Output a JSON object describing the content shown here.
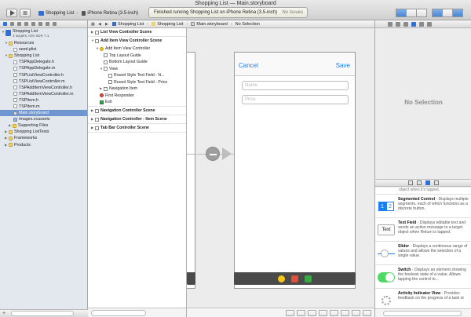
{
  "window": {
    "title": "Shopping List — Main.storyboard"
  },
  "toolbar": {
    "scheme": "Shopping List",
    "device": "iPhone Retina (3.5-inch)",
    "activity_status": "Finished running Shopping List on iPhone Retina (3.5-inch)",
    "issues": "No Issues"
  },
  "navigator": {
    "project_name": "Shopping List",
    "project_subtitle": "2 targets, iOS SDK 7.1",
    "items": [
      {
        "label": "Resources"
      },
      {
        "label": "seed.plist"
      },
      {
        "label": "Shopping List"
      },
      {
        "label": "TSPAppDelegate.h"
      },
      {
        "label": "TSPAppDelegate.m"
      },
      {
        "label": "TSPListViewController.h"
      },
      {
        "label": "TSPListViewController.m"
      },
      {
        "label": "TSPAddItemViewController.h"
      },
      {
        "label": "TSPAddItemViewController.m"
      },
      {
        "label": "TSPItem.h"
      },
      {
        "label": "TSPItem.m"
      },
      {
        "label": "Main.storyboard"
      },
      {
        "label": "Images.xcassets"
      },
      {
        "label": "Supporting Files"
      },
      {
        "label": "Shopping ListTests"
      },
      {
        "label": "Frameworks"
      },
      {
        "label": "Products"
      }
    ]
  },
  "jumpbar": {
    "crumbs": [
      "Shopping List",
      "Shopping List",
      "Main.storyboard",
      "No Selection"
    ]
  },
  "outline": {
    "rows": [
      {
        "label": "List View Controller Scene"
      },
      {
        "label": "Add Item View Controller Scene"
      },
      {
        "label": "Add Item View Controller"
      },
      {
        "label": "Top Layout Guide"
      },
      {
        "label": "Bottom Layout Guide"
      },
      {
        "label": "View"
      },
      {
        "label": "Round Style Text Field - N..."
      },
      {
        "label": "Round Style Text Field - Price"
      },
      {
        "label": "Navigation Item"
      },
      {
        "label": "First Responder"
      },
      {
        "label": "Exit"
      },
      {
        "label": "Navigation Controller Scene"
      },
      {
        "label": "Navigation Controller - Item Scene"
      },
      {
        "label": "Tab Bar Controller Scene"
      }
    ]
  },
  "canvas": {
    "cancel": "Cancel",
    "save": "Save",
    "name_placeholder": "Name",
    "price_placeholder": "Price"
  },
  "inspector": {
    "no_selection": "No Selection"
  },
  "library": {
    "top_fragment": "object when it's tapped.",
    "items": [
      {
        "title": "Segmented Control",
        "desc": " - Displays multiple segments, each of which functions as a discrete button.",
        "icon_text": "2"
      },
      {
        "title": "Text Field",
        "desc": " - Displays editable text and sends an action message to a target object when Return is tapped.",
        "icon_text": "Text"
      },
      {
        "title": "Slider",
        "desc": " - Displays a continuous range of values and allows the selection of a single value."
      },
      {
        "title": "Switch",
        "desc": " - Displays an element showing the boolean state of a value. Allows tapping the control to..."
      },
      {
        "title": "Activity Indicator View",
        "desc": " - Provides feedback on the progress of a task or"
      }
    ]
  },
  "colors": {
    "accent": "#1a7ff6",
    "selection": "#6f96cf",
    "switch_on": "#4cd964"
  }
}
